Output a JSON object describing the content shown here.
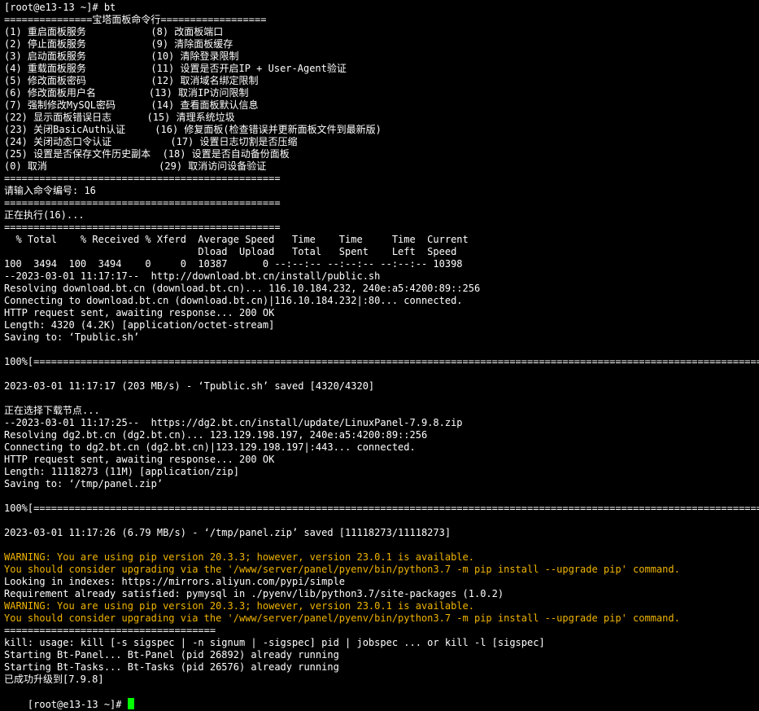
{
  "terminal": {
    "lines": [
      {
        "text": "[root@e13-13 ~]# bt",
        "color": "#ffffff"
      },
      {
        "text": "===============宝塔面板命令行==================",
        "color": "#ffffff"
      },
      {
        "text": "(1) 重启面板服务           (8) 改面板端口",
        "color": "#ffffff"
      },
      {
        "text": "(2) 停止面板服务           (9) 清除面板缓存",
        "color": "#ffffff"
      },
      {
        "text": "(3) 启动面板服务           (10) 清除登录限制",
        "color": "#ffffff"
      },
      {
        "text": "(4) 重载面板服务           (11) 设置是否开启IP + User-Agent验证",
        "color": "#ffffff"
      },
      {
        "text": "(5) 修改面板密码           (12) 取消域名绑定限制",
        "color": "#ffffff"
      },
      {
        "text": "(6) 修改面板用户名         (13) 取消IP访问限制",
        "color": "#ffffff"
      },
      {
        "text": "(7) 强制修改MySQL密码      (14) 查看面板默认信息",
        "color": "#ffffff"
      },
      {
        "text": "(22) 显示面板错误日志      (15) 清理系统垃圾",
        "color": "#ffffff"
      },
      {
        "text": "(23) 关闭BasicAuth认证     (16) 修复面板(检查错误并更新面板文件到最新版)",
        "color": "#ffffff"
      },
      {
        "text": "(24) 关闭动态口令认证          (17) 设置日志切割是否压缩",
        "color": "#ffffff"
      },
      {
        "text": "(25) 设置是否保存文件历史副本  (18) 设置是否自动备份面板",
        "color": "#ffffff"
      },
      {
        "text": "(0) 取消                   (29) 取消访问设备验证",
        "color": "#ffffff"
      },
      {
        "text": "===============================================",
        "color": "#ffffff"
      },
      {
        "text": "请输入命令编号: 16",
        "color": "#ffffff"
      },
      {
        "text": "===============================================",
        "color": "#ffffff"
      },
      {
        "text": "正在执行(16)...",
        "color": "#ffffff"
      },
      {
        "text": "===============================================",
        "color": "#ffffff"
      },
      {
        "text": "  % Total    % Received % Xferd  Average Speed   Time    Time     Time  Current",
        "color": "#ffffff"
      },
      {
        "text": "                                 Dload  Upload   Total   Spent    Left  Speed",
        "color": "#ffffff"
      },
      {
        "text": "100  3494  100  3494    0     0  10387      0 --:--:-- --:--:-- --:--:-- 10398",
        "color": "#ffffff"
      },
      {
        "text": "--2023-03-01 11:17:17--  http://download.bt.cn/install/public.sh",
        "color": "#ffffff"
      },
      {
        "text": "Resolving download.bt.cn (download.bt.cn)... 116.10.184.232, 240e:a5:4200:89::256",
        "color": "#ffffff"
      },
      {
        "text": "Connecting to download.bt.cn (download.bt.cn)|116.10.184.232|:80... connected.",
        "color": "#ffffff"
      },
      {
        "text": "HTTP request sent, awaiting response... 200 OK",
        "color": "#ffffff"
      },
      {
        "text": "Length: 4320 (4.2K) [application/octet-stream]",
        "color": "#ffffff"
      },
      {
        "text": "Saving to: ‘Tpublic.sh’",
        "color": "#ffffff"
      },
      {
        "text": "",
        "color": "#ffffff"
      },
      {
        "text": "100%[=====================================================================================================================================================================",
        "color": "#ffffff"
      },
      {
        "text": "",
        "color": "#ffffff"
      },
      {
        "text": "2023-03-01 11:17:17 (203 MB/s) - ‘Tpublic.sh’ saved [4320/4320]",
        "color": "#ffffff"
      },
      {
        "text": "",
        "color": "#ffffff"
      },
      {
        "text": "正在选择下载节点...",
        "color": "#ffffff"
      },
      {
        "text": "--2023-03-01 11:17:25--  https://dg2.bt.cn/install/update/LinuxPanel-7.9.8.zip",
        "color": "#ffffff"
      },
      {
        "text": "Resolving dg2.bt.cn (dg2.bt.cn)... 123.129.198.197, 240e:a5:4200:89::256",
        "color": "#ffffff"
      },
      {
        "text": "Connecting to dg2.bt.cn (dg2.bt.cn)|123.129.198.197|:443... connected.",
        "color": "#ffffff"
      },
      {
        "text": "HTTP request sent, awaiting response... 200 OK",
        "color": "#ffffff"
      },
      {
        "text": "Length: 11118273 (11M) [application/zip]",
        "color": "#ffffff"
      },
      {
        "text": "Saving to: ‘/tmp/panel.zip’",
        "color": "#ffffff"
      },
      {
        "text": "",
        "color": "#ffffff"
      },
      {
        "text": "100%[=====================================================================================================================================================================",
        "color": "#ffffff"
      },
      {
        "text": "",
        "color": "#ffffff"
      },
      {
        "text": "2023-03-01 11:17:26 (6.79 MB/s) - ‘/tmp/panel.zip’ saved [11118273/11118273]",
        "color": "#ffffff"
      },
      {
        "text": "",
        "color": "#ffffff"
      },
      {
        "text": "WARNING: You are using pip version 20.3.3; however, version 23.0.1 is available.",
        "color": "#f0b400"
      },
      {
        "text": "You should consider upgrading via the '/www/server/panel/pyenv/bin/python3.7 -m pip install --upgrade pip' command.",
        "color": "#f0b400"
      },
      {
        "text": "Looking in indexes: https://mirrors.aliyun.com/pypi/simple",
        "color": "#ffffff"
      },
      {
        "text": "Requirement already satisfied: pymysql in ./pyenv/lib/python3.7/site-packages (1.0.2)",
        "color": "#ffffff"
      },
      {
        "text": "WARNING: You are using pip version 20.3.3; however, version 23.0.1 is available.",
        "color": "#f0b400"
      },
      {
        "text": "You should consider upgrading via the '/www/server/panel/pyenv/bin/python3.7 -m pip install --upgrade pip' command.",
        "color": "#f0b400"
      },
      {
        "text": "====================================",
        "color": "#ffffff"
      },
      {
        "text": "kill: usage: kill [-s sigspec | -n signum | -sigspec] pid | jobspec ... or kill -l [sigspec]",
        "color": "#ffffff"
      },
      {
        "text": "Starting Bt-Panel... Bt-Panel (pid 26892) already running",
        "color": "#ffffff"
      },
      {
        "text": "Starting Bt-Tasks... Bt-Tasks (pid 26576) already running",
        "color": "#ffffff"
      },
      {
        "text": "已成功升级到[7.9.8]",
        "color": "#ffffff"
      }
    ],
    "prompt": "[root@e13-13 ~]# ",
    "cursor_color": "#00ff00",
    "background": "#000000"
  }
}
